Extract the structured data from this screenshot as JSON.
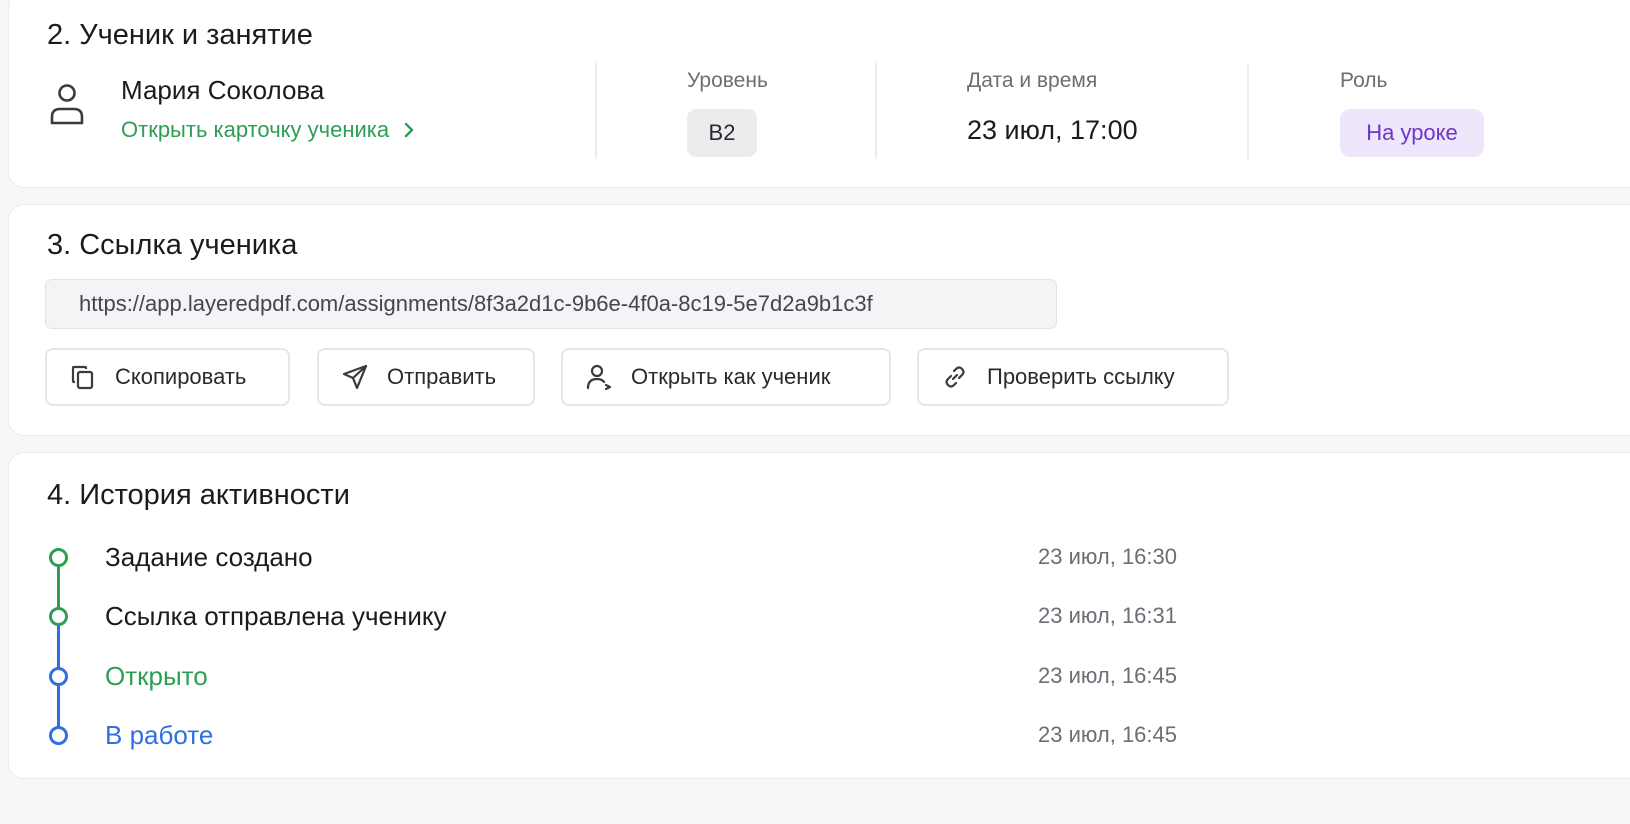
{
  "colors": {
    "green": "#2e9e54",
    "blue": "#2f6fe0",
    "purple": "#6e35c9",
    "purple_bg": "#efe6fc"
  },
  "student_section": {
    "title": "2. Ученик и занятие",
    "student_name": "Мария Соколова",
    "open_card_link": "Открыть карточку ученика",
    "level_label": "Уровень",
    "level_value": "B2",
    "datetime_label": "Дата и время",
    "datetime_value": "23 июл, 17:00",
    "role_label": "Роль",
    "role_value": "На уроке"
  },
  "link_section": {
    "title": "3. Ссылка ученика",
    "url": "https://app.layeredpdf.com/assignments/8f3a2d1c-9b6e-4f0a-8c19-5e7d2a9b1c3f",
    "buttons": {
      "copy": "Скопировать",
      "send": "Отправить",
      "open_as_student": "Открыть как ученик",
      "check_link": "Проверить ссылку"
    }
  },
  "history_section": {
    "title": "4. История активности",
    "events": [
      {
        "label": "Задание создано",
        "time": "23 июл, 16:30",
        "status": "green"
      },
      {
        "label": "Ссылка отправлена ученику",
        "time": "23 июл, 16:31",
        "status": "green"
      },
      {
        "label": "Открыто",
        "time": "23 июл, 16:45",
        "status": "blue"
      },
      {
        "label": "В работе",
        "time": "23 июл, 16:45",
        "status": "blue"
      }
    ]
  }
}
